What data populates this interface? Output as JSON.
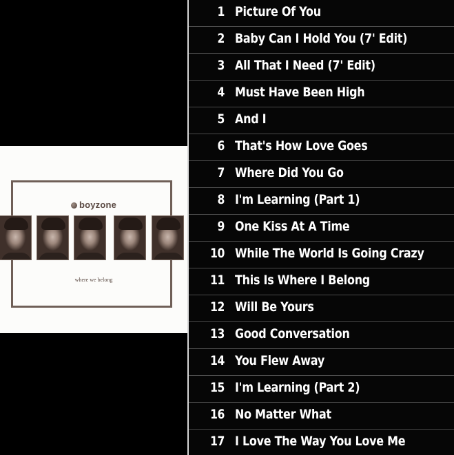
{
  "album": {
    "brand": "boyzone",
    "subtitle": "where we belong"
  },
  "tracks": [
    {
      "num": "1",
      "title": "Picture Of You"
    },
    {
      "num": "2",
      "title": "Baby Can I Hold You (7' Edit)"
    },
    {
      "num": "3",
      "title": "All That I Need (7' Edit)"
    },
    {
      "num": "4",
      "title": "Must Have Been High"
    },
    {
      "num": "5",
      "title": "And I"
    },
    {
      "num": "6",
      "title": "That's How Love Goes"
    },
    {
      "num": "7",
      "title": "Where Did You Go"
    },
    {
      "num": "8",
      "title": "I'm Learning (Part 1)"
    },
    {
      "num": "9",
      "title": "One Kiss At A Time"
    },
    {
      "num": "10",
      "title": "While The World Is Going Crazy"
    },
    {
      "num": "11",
      "title": "This Is Where I Belong"
    },
    {
      "num": "12",
      "title": "Will Be Yours"
    },
    {
      "num": "13",
      "title": "Good Conversation"
    },
    {
      "num": "14",
      "title": "You Flew Away"
    },
    {
      "num": "15",
      "title": "I'm Learning (Part 2)"
    },
    {
      "num": "16",
      "title": "No Matter What"
    },
    {
      "num": "17",
      "title": "I Love The Way You Love Me"
    }
  ]
}
